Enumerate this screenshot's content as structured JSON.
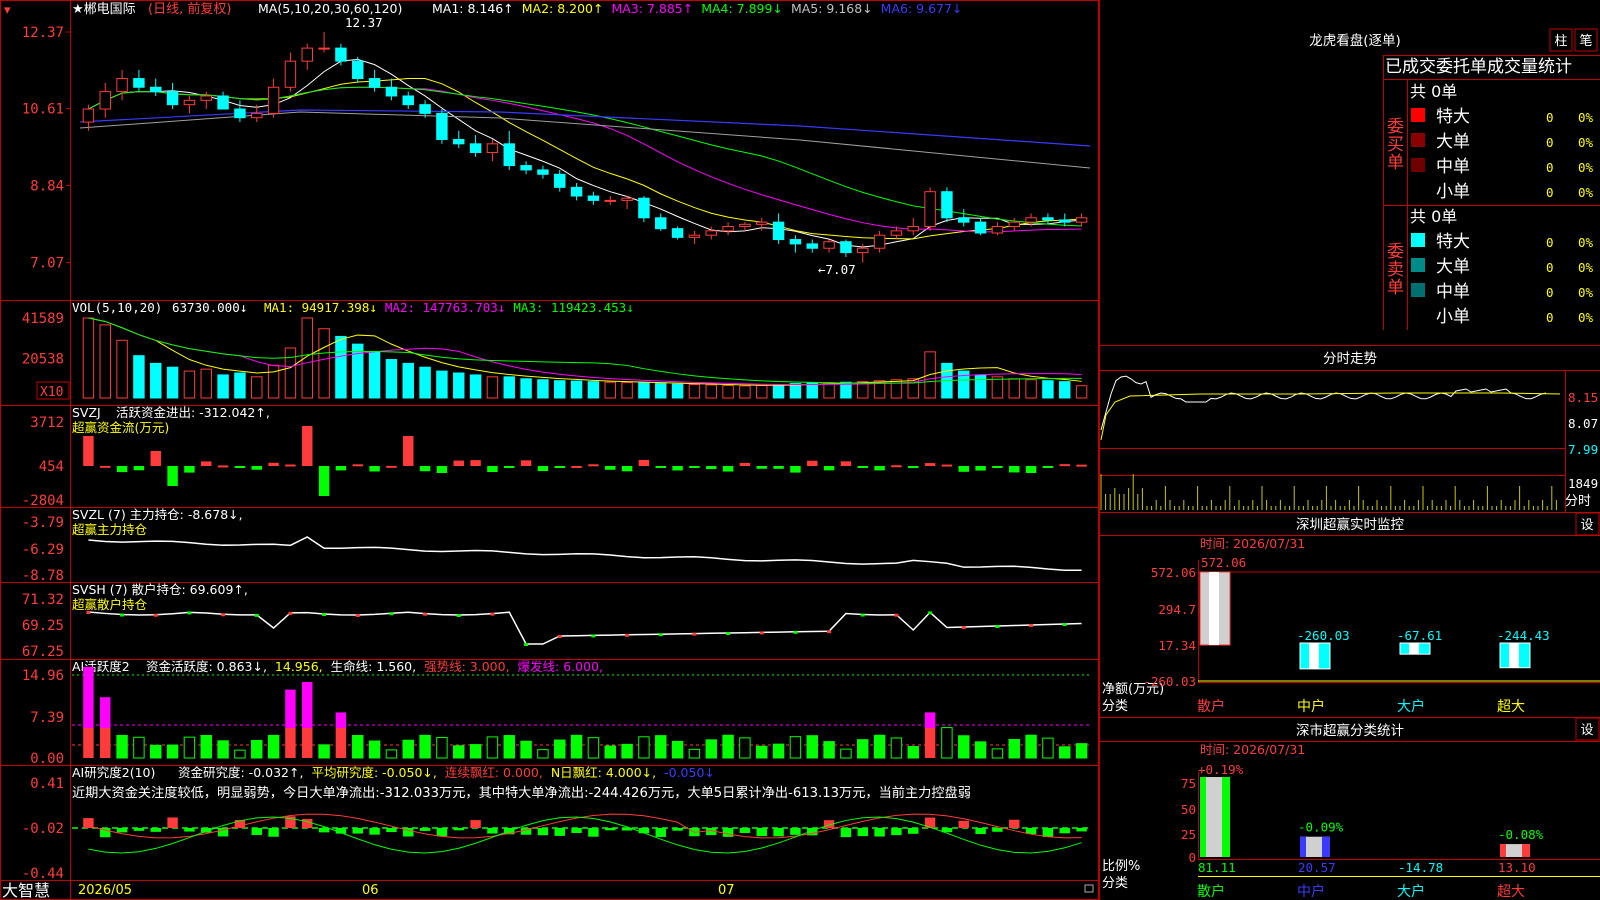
{
  "colors": {
    "up": "#ff3b3b",
    "down": "#00ffff",
    "frame": "#c00000",
    "ma1": "#ffffff",
    "ma2": "#ffff00",
    "ma3": "#ff00ff",
    "ma4": "#00ff00",
    "ma5": "#a0a0a0",
    "ma6": "#3a3aff",
    "green": "#00ff00",
    "magenta": "#ff00ff",
    "yellow": "#ffff00",
    "white": "#ffffff"
  },
  "main": {
    "star_name": "★郴电国际",
    "period_mode": "(日线, 前复权)",
    "ma_header": "MA(5,10,20,30,60,120)",
    "ma_items": [
      {
        "label": "MA1: 8.146↑",
        "color": "#ffffff"
      },
      {
        "label": "MA2: 8.200↑",
        "color": "#ffff00"
      },
      {
        "label": "MA3: 7.885↑",
        "color": "#ff00ff"
      },
      {
        "label": "MA4: 7.899↓",
        "color": "#00ff00"
      },
      {
        "label": "MA5: 9.168↓",
        "color": "#c0c0c0"
      },
      {
        "label": "MA6: 9.677↓",
        "color": "#3a3aff"
      }
    ],
    "y_ticks": [
      "12.37",
      "10.61",
      "8.84",
      "7.07"
    ],
    "high_label": "12.37",
    "low_label": "←7.07"
  },
  "vol": {
    "header": "VOL(5,10,20)",
    "value": "63730.000↓",
    "ma": [
      {
        "label": "MA1: 94917.398↓",
        "color": "#ffff00"
      },
      {
        "label": "MA2: 147763.703↓",
        "color": "#ff00ff"
      },
      {
        "label": "MA3: 119423.453↓",
        "color": "#00ff00"
      }
    ],
    "y_ticks": [
      "41589",
      "20538"
    ],
    "unit": "X10"
  },
  "svzj": {
    "name": "SVZJ",
    "line1": "活跃资金进出: -312.042↑,",
    "line2": "超赢资金流(万元)",
    "y_ticks": [
      "3712",
      "454",
      "-2804"
    ]
  },
  "svzl": {
    "name": "SVZL (7) 主力持仓: -8.678↓,",
    "line2": "超赢主力持仓",
    "y_ticks": [
      "-3.79",
      "-6.29",
      "-8.78"
    ]
  },
  "svsh": {
    "name": "SVSH (7) 散户持仓: 69.609↑,",
    "line2": "超赢散户持仓",
    "y_ticks": [
      "71.32",
      "69.25",
      "67.25"
    ]
  },
  "ai1": {
    "name": "AI活跃度2",
    "items": [
      {
        "label": "资金活跃度: 0.863↓,",
        "color": "#ffffff"
      },
      {
        "label": "14.956,",
        "color": "#ffff00"
      },
      {
        "label": "生命线: 1.560,",
        "color": "#ffffff"
      },
      {
        "label": "强势线: 3.000,",
        "color": "#ff3b3b"
      },
      {
        "label": "爆发线: 6.000,",
        "color": "#ff00ff"
      }
    ],
    "y_ticks": [
      "14.96",
      "7.39",
      "0.00"
    ]
  },
  "ai2": {
    "name": "AI研究度2(10)",
    "items": [
      {
        "label": "资金研究度: -0.032↑,",
        "color": "#ffffff"
      },
      {
        "label": "平均研究度: -0.050↓,",
        "color": "#ffff00"
      },
      {
        "label": "连续飘红: 0.000,",
        "color": "#ff3b3b"
      },
      {
        "label": "N日飘红: 4.000↓,",
        "color": "#ffff00"
      },
      {
        "label": "-0.050↓",
        "color": "#3a3aff"
      }
    ],
    "comment": "近期大资金关注度较低，明显弱势，今日大单净流出:-312.033万元，其中特大单净流出:-244.426万元，大单5日累计净出-613.13万元，当前主力控盘弱",
    "y_ticks": [
      "0.41",
      "-0.02",
      "-0.44"
    ]
  },
  "bottom": {
    "logo": "大智慧",
    "dates": [
      "2026/05",
      "06",
      "07"
    ]
  },
  "right": {
    "lhb_title": "龙虎看盘(逐单)",
    "btn_zhu": "柱",
    "btn_bi": "笔",
    "table_title": "已成交委托单成交量统计",
    "buy_label": "委买单",
    "sell_label": "委卖单",
    "buy_total": "共 0单",
    "sell_total": "共 0单",
    "buy_rows": [
      {
        "label": "特大",
        "count": "0",
        "pct": "0%",
        "color": "#ff0000"
      },
      {
        "label": "大单",
        "count": "0",
        "pct": "0%",
        "color": "#8b0000"
      },
      {
        "label": "中单",
        "count": "0",
        "pct": "0%",
        "color": "#700000"
      },
      {
        "label": "小单",
        "count": "0",
        "pct": "0%",
        "color": ""
      }
    ],
    "sell_rows": [
      {
        "label": "特大",
        "count": "0",
        "pct": "0%",
        "color": "#00ffff"
      },
      {
        "label": "大单",
        "count": "0",
        "pct": "0%",
        "color": "#008b8b"
      },
      {
        "label": "中单",
        "count": "0",
        "pct": "0%",
        "color": "#007070"
      },
      {
        "label": "小单",
        "count": "0",
        "pct": "0%",
        "color": ""
      }
    ],
    "fs_title": "分时走势",
    "fs_ticks": [
      "8.15",
      "8.07",
      "7.99"
    ],
    "fs_vol": "1849",
    "fs_unit": "分时",
    "sz_title": "深圳超赢实时监控",
    "set_btn": "设",
    "sz_time": "时间: 2026/07/31",
    "sz_ticks": [
      "572.06",
      "294.7",
      "17.34",
      "-260.03"
    ],
    "sz_unit": "净额(万元)",
    "sz_cat": "分类",
    "sz_categories": [
      "散户",
      "中户",
      "大户",
      "超大"
    ],
    "sz_values": [
      "572.06",
      "-260.03",
      "-67.61",
      "-244.43"
    ],
    "ss_title": "深市超赢分类统计",
    "ss_time": "时间: 2026/07/31",
    "ss_ticks": [
      "75",
      "50",
      "25",
      "0"
    ],
    "ss_unit": "比例%",
    "ss_cat": "分类",
    "ss_pcts": [
      "+0.19%",
      "-0.09%",
      "",
      "-0.08%"
    ],
    "ss_values": [
      "81.11",
      "20.57",
      "-14.78",
      "13.10"
    ]
  },
  "chart_data": {
    "type": "candlestick",
    "title": "郴电国际 (日线, 前复权)",
    "ylim": [
      7.07,
      12.37
    ],
    "ohlc": [
      [
        10.3,
        10.7,
        10.1,
        10.6
      ],
      [
        10.6,
        11.2,
        10.4,
        11.0
      ],
      [
        11.0,
        11.5,
        10.8,
        11.3
      ],
      [
        11.3,
        11.5,
        11.0,
        11.1
      ],
      [
        11.1,
        11.3,
        10.9,
        11.0
      ],
      [
        11.0,
        11.2,
        10.6,
        10.7
      ],
      [
        10.7,
        10.9,
        10.5,
        10.8
      ],
      [
        10.8,
        11.0,
        10.6,
        10.9
      ],
      [
        10.9,
        11.0,
        10.6,
        10.6
      ],
      [
        10.6,
        10.8,
        10.3,
        10.4
      ],
      [
        10.4,
        10.7,
        10.3,
        10.5
      ],
      [
        10.5,
        11.3,
        10.4,
        11.1
      ],
      [
        11.1,
        11.9,
        11.0,
        11.7
      ],
      [
        11.7,
        12.1,
        11.5,
        12.0
      ],
      [
        12.0,
        12.37,
        11.9,
        12.0
      ],
      [
        12.0,
        12.1,
        11.6,
        11.7
      ],
      [
        11.7,
        11.8,
        11.2,
        11.3
      ],
      [
        11.3,
        11.5,
        11.0,
        11.1
      ],
      [
        11.1,
        11.3,
        10.8,
        10.9
      ],
      [
        10.9,
        11.0,
        10.6,
        10.7
      ],
      [
        10.7,
        10.8,
        10.4,
        10.5
      ],
      [
        10.5,
        10.6,
        9.8,
        9.9
      ],
      [
        9.9,
        10.1,
        9.7,
        9.8
      ],
      [
        9.8,
        10.0,
        9.5,
        9.6
      ],
      [
        9.6,
        9.9,
        9.4,
        9.8
      ],
      [
        9.8,
        10.1,
        9.2,
        9.3
      ],
      [
        9.3,
        9.4,
        9.1,
        9.2
      ],
      [
        9.2,
        9.3,
        9.0,
        9.1
      ],
      [
        9.1,
        9.2,
        8.7,
        8.8
      ],
      [
        8.8,
        8.9,
        8.5,
        8.6
      ],
      [
        8.6,
        8.7,
        8.4,
        8.5
      ],
      [
        8.5,
        8.6,
        8.4,
        8.5
      ],
      [
        8.5,
        8.6,
        8.3,
        8.55
      ],
      [
        8.55,
        8.6,
        8.0,
        8.1
      ],
      [
        8.1,
        8.2,
        7.8,
        7.85
      ],
      [
        7.85,
        7.9,
        7.6,
        7.65
      ],
      [
        7.65,
        7.8,
        7.5,
        7.7
      ],
      [
        7.7,
        7.9,
        7.6,
        7.8
      ],
      [
        7.8,
        8.0,
        7.7,
        7.9
      ],
      [
        7.9,
        8.0,
        7.8,
        7.95
      ],
      [
        7.95,
        8.1,
        7.8,
        8.0
      ],
      [
        8.0,
        8.2,
        7.5,
        7.6
      ],
      [
        7.6,
        7.7,
        7.3,
        7.5
      ],
      [
        7.5,
        7.6,
        7.3,
        7.4
      ],
      [
        7.4,
        7.6,
        7.3,
        7.55
      ],
      [
        7.55,
        7.6,
        7.2,
        7.3
      ],
      [
        7.3,
        7.5,
        7.07,
        7.4
      ],
      [
        7.4,
        7.8,
        7.3,
        7.7
      ],
      [
        7.7,
        7.9,
        7.6,
        7.8
      ],
      [
        7.8,
        8.1,
        7.7,
        7.9
      ],
      [
        7.9,
        8.8,
        7.8,
        8.7
      ],
      [
        8.7,
        8.8,
        8.0,
        8.1
      ],
      [
        8.1,
        8.3,
        7.9,
        8.0
      ],
      [
        8.0,
        8.1,
        7.7,
        7.75
      ],
      [
        7.75,
        8.0,
        7.7,
        7.9
      ],
      [
        7.9,
        8.1,
        7.8,
        8.0
      ],
      [
        8.0,
        8.2,
        7.9,
        8.1
      ],
      [
        8.1,
        8.2,
        7.95,
        8.05
      ],
      [
        8.05,
        8.2,
        7.9,
        8.0
      ],
      [
        8.0,
        8.2,
        7.9,
        8.1
      ]
    ],
    "volume": [
      41589,
      38000,
      30000,
      22000,
      18000,
      16000,
      14000,
      15000,
      12000,
      13000,
      11000,
      17000,
      26000,
      41589,
      36000,
      32000,
      28000,
      24000,
      20000,
      18000,
      16000,
      14000,
      13000,
      12000,
      11000,
      11000,
      10000,
      9500,
      9000,
      8800,
      8500,
      8200,
      8000,
      7800,
      7500,
      7200,
      7000,
      6800,
      6500,
      6300,
      6500,
      7000,
      7500,
      7800,
      8000,
      8200,
      8500,
      9000,
      9500,
      10000,
      24000,
      18000,
      14000,
      12000,
      11000,
      10000,
      9500,
      9000,
      8500,
      6373
    ]
  }
}
